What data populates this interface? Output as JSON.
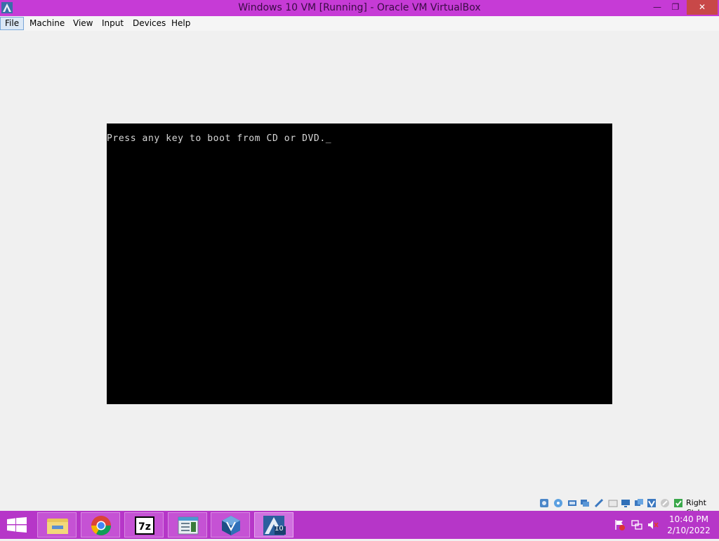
{
  "window": {
    "title": "Windows 10 VM [Running] - Oracle VM VirtualBox",
    "minimize_icon": "minimize-icon",
    "restore_icon": "restore-icon",
    "close_icon": "close-icon"
  },
  "menu": {
    "items": [
      "File",
      "Machine",
      "View",
      "Input",
      "Devices",
      "Help"
    ],
    "active": "File"
  },
  "vm": {
    "boot_message": "Press any key to boot from CD or DVD.",
    "cursor": "_"
  },
  "statusbar": {
    "icons": [
      "hard-disk-icon",
      "optical-drive-icon",
      "audio-icon",
      "network-icon",
      "usb-icon",
      "shared-folders-icon",
      "display-icon",
      "video-capture-icon",
      "virtualization-icon",
      "mouse-integration-icon",
      "host-key-icon"
    ],
    "host_key": "Right Ctrl"
  },
  "taskbar": {
    "apps": [
      "file-explorer-icon",
      "chrome-icon",
      "7zip-icon",
      "notepad-icon",
      "virtualbox-manager-icon",
      "windows10-vm-icon"
    ],
    "vm_badge": "10",
    "tray_icons": [
      "action-center-flag-icon",
      "network-icon",
      "volume-muted-icon"
    ],
    "time": "10:40 PM",
    "date": "2/10/2022"
  },
  "colors": {
    "titlebar": "#c63bd6",
    "taskbar": "#b636c8",
    "close_button": "#c84848"
  }
}
